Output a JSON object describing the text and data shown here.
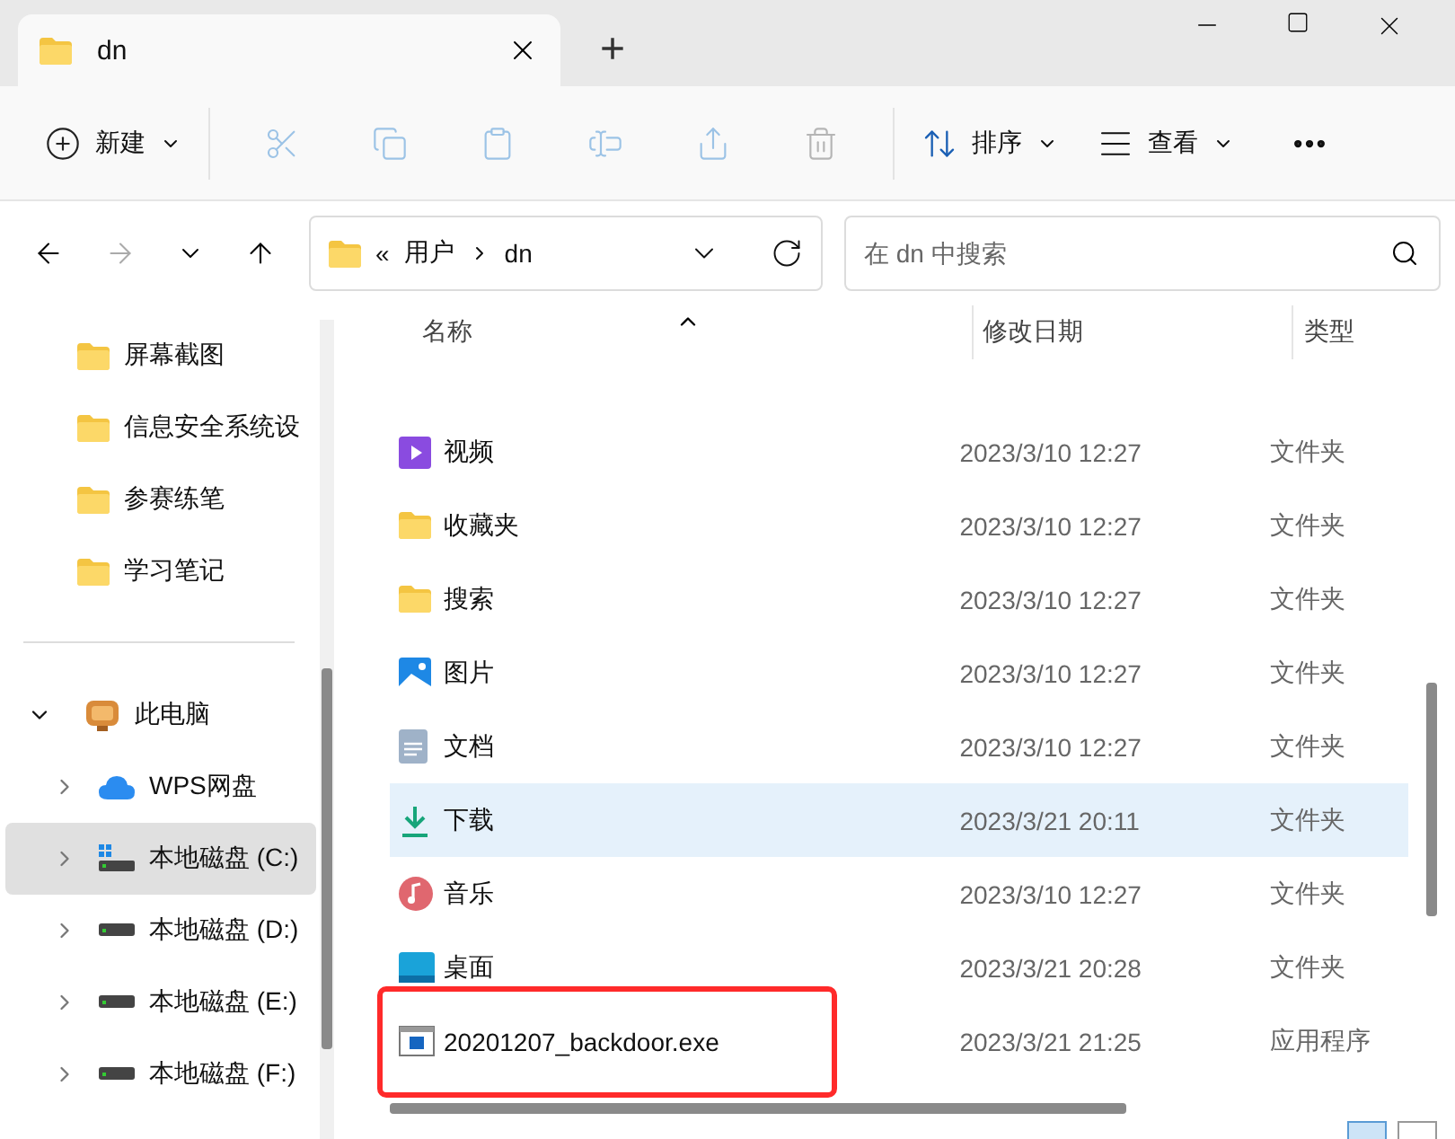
{
  "window": {
    "tab_title": "dn",
    "new_tab": "+"
  },
  "toolbar": {
    "new_label": "新建",
    "actions": [
      {
        "kind": "cut",
        "disabled": true
      },
      {
        "kind": "copy",
        "disabled": true
      },
      {
        "kind": "paste",
        "disabled": true
      },
      {
        "kind": "rename",
        "disabled": true
      },
      {
        "kind": "share",
        "disabled": true
      },
      {
        "kind": "delete",
        "disabled": true
      }
    ],
    "sort_label": "排序",
    "view_label": "查看"
  },
  "address": {
    "overflow": "«",
    "path": [
      "用户",
      "dn"
    ]
  },
  "search": {
    "placeholder": "在 dn 中搜索"
  },
  "sidebar": {
    "quick": [
      {
        "label": "屏幕截图"
      },
      {
        "label": "信息安全系统设"
      },
      {
        "label": "参赛练笔"
      },
      {
        "label": "学习笔记"
      }
    ],
    "tree": {
      "label": "此电脑",
      "expanded": true,
      "children": [
        {
          "label": "WPS网盘",
          "kind": "cloud",
          "selected": false,
          "expanded": false
        },
        {
          "label": "本地磁盘 (C:)",
          "kind": "system-drive",
          "selected": true,
          "expanded": false
        },
        {
          "label": "本地磁盘 (D:)",
          "kind": "drive",
          "selected": false,
          "expanded": false
        },
        {
          "label": "本地磁盘 (E:)",
          "kind": "drive",
          "selected": false,
          "expanded": false
        },
        {
          "label": "本地磁盘 (F:)",
          "kind": "drive",
          "selected": false,
          "expanded": false
        }
      ]
    }
  },
  "table": {
    "columns": [
      "名称",
      "修改日期",
      "类型"
    ],
    "rows": [
      {
        "kind": "video",
        "name": "视频",
        "date": "2023/3/10 12:27",
        "type": "文件夹",
        "selected": false,
        "annotated": false
      },
      {
        "kind": "folder",
        "name": "收藏夹",
        "date": "2023/3/10 12:27",
        "type": "文件夹",
        "selected": false,
        "annotated": false
      },
      {
        "kind": "folder",
        "name": "搜索",
        "date": "2023/3/10 12:27",
        "type": "文件夹",
        "selected": false,
        "annotated": false
      },
      {
        "kind": "picture",
        "name": "图片",
        "date": "2023/3/10 12:27",
        "type": "文件夹",
        "selected": false,
        "annotated": false
      },
      {
        "kind": "document",
        "name": "文档",
        "date": "2023/3/10 12:27",
        "type": "文件夹",
        "selected": false,
        "annotated": false
      },
      {
        "kind": "download",
        "name": "下载",
        "date": "2023/3/21 20:11",
        "type": "文件夹",
        "selected": true,
        "annotated": false
      },
      {
        "kind": "music",
        "name": "音乐",
        "date": "2023/3/10 12:27",
        "type": "文件夹",
        "selected": false,
        "annotated": false
      },
      {
        "kind": "desktop",
        "name": "桌面",
        "date": "2023/3/21 20:28",
        "type": "文件夹",
        "selected": false,
        "annotated": false
      },
      {
        "kind": "exe",
        "name": "20201207_backdoor.exe",
        "date": "2023/3/21 21:25",
        "type": "应用程序",
        "selected": false,
        "annotated": true
      }
    ]
  }
}
